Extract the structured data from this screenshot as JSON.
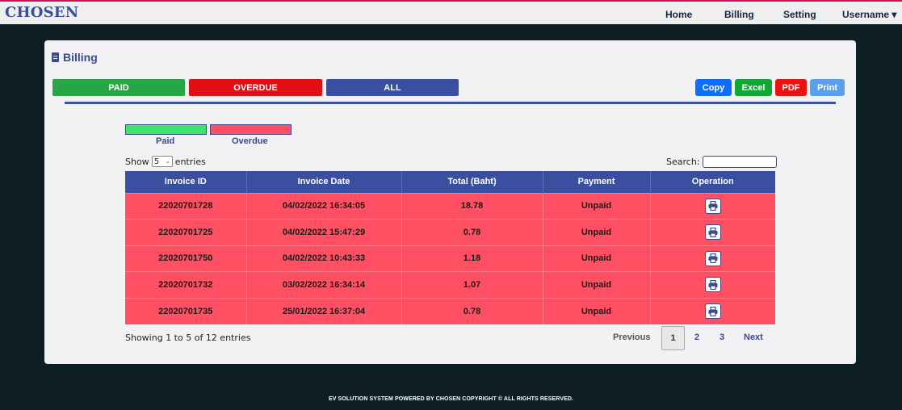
{
  "header": {
    "brand": "CHOSEN",
    "nav": {
      "home": "Home",
      "billing": "Billing",
      "setting": "Setting",
      "user": "Username ▾"
    }
  },
  "page": {
    "title": "Billing",
    "title_icon": "document-icon"
  },
  "filters": {
    "paid": "PAID",
    "overdue": "OVERDUE",
    "all": "ALL"
  },
  "export": {
    "copy": "Copy",
    "excel": "Excel",
    "pdf": "PDF",
    "print": "Print"
  },
  "legend": {
    "paid": "Paid",
    "overdue": "Overdue",
    "paid_color": "#3ee46a",
    "overdue_color": "#ff4f63"
  },
  "table_controls": {
    "show_prefix": "Show",
    "page_length": "5",
    "show_suffix": "entries",
    "search_label": "Search:",
    "search_value": ""
  },
  "table": {
    "columns": [
      "Invoice ID",
      "Invoice Date",
      "Total (Baht)",
      "Payment",
      "Operation"
    ],
    "rows": [
      {
        "id": "22020701728",
        "date": "04/02/2022 16:34:05",
        "total": "18.78",
        "payment": "Unpaid"
      },
      {
        "id": "22020701725",
        "date": "04/02/2022 15:47:29",
        "total": "0.78",
        "payment": "Unpaid"
      },
      {
        "id": "22020701750",
        "date": "04/02/2022 10:43:33",
        "total": "1.18",
        "payment": "Unpaid"
      },
      {
        "id": "22020701732",
        "date": "03/02/2022 16:34:14",
        "total": "1.07",
        "payment": "Unpaid"
      },
      {
        "id": "22020701735",
        "date": "25/01/2022 16:37:04",
        "total": "0.78",
        "payment": "Unpaid"
      }
    ]
  },
  "pagination": {
    "info": "Showing 1 to 5 of 12 entries",
    "previous": "Previous",
    "pages": [
      "1",
      "2",
      "3"
    ],
    "current": "1",
    "next": "Next"
  },
  "footer": {
    "text": "EV SOLUTION SYSTEM POWERED BY CHOSEN COPYRIGHT © ALL RIGHTS RESERVED."
  },
  "colors": {
    "brand": "#3a4fa0",
    "overdue_row": "#ff4f63",
    "background": "#0e1f24"
  }
}
